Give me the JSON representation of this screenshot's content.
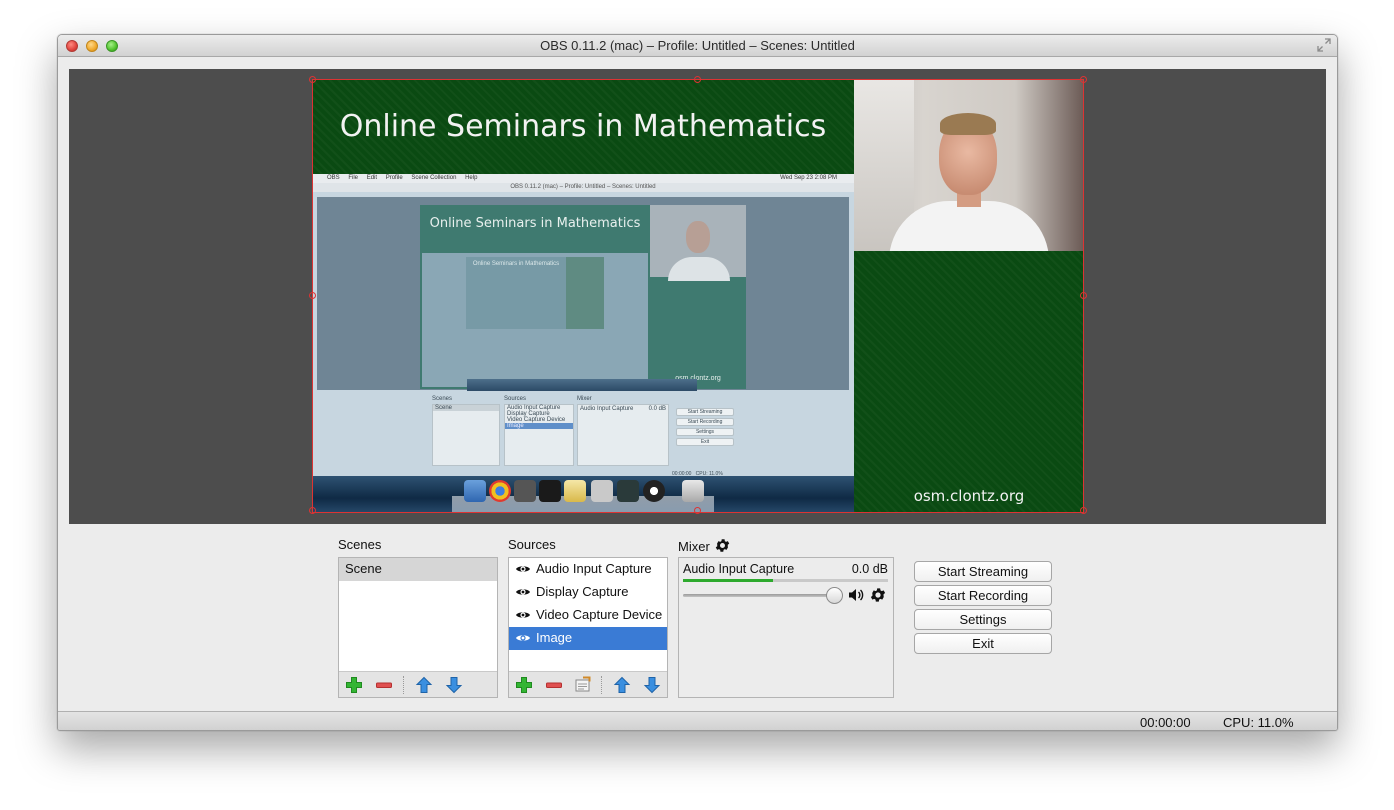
{
  "window": {
    "title": "OBS 0.11.2 (mac) – Profile: Untitled – Scenes: Untitled"
  },
  "preview": {
    "slide_title": "Online Seminars in Mathematics",
    "url_label": "osm.clontz.org",
    "nested": {
      "menubar": [
        "OBS",
        "File",
        "Edit",
        "Profile",
        "Scene Collection",
        "Help"
      ],
      "menubar_right": "Wed Sep 23  2:08 PM",
      "titlebar": "OBS 0.11.2 (mac) – Profile: Untitled – Scenes: Untitled",
      "slide_title": "Online Seminars in Mathematics",
      "inner_title": "Online Seminars in Mathematics",
      "url_label": "osm.clontz.org",
      "scenes_label": "Scenes",
      "scene_item": "Scene",
      "sources_label": "Sources",
      "sources": [
        "Audio Input Capture",
        "Display Capture",
        "Video Capture Device",
        "Image"
      ],
      "mixer_label": "Mixer",
      "mixer_item": "Audio Input Capture",
      "mixer_db": "0.0 dB",
      "buttons": [
        "Start Streaming",
        "Start Recording",
        "Settings",
        "Exit"
      ],
      "status_time": "00:00:00",
      "status_cpu": "CPU: 11.0%"
    }
  },
  "scenes": {
    "label": "Scenes",
    "items": [
      "Scene"
    ],
    "selected_index": 0
  },
  "sources": {
    "label": "Sources",
    "items": [
      "Audio Input Capture",
      "Display Capture",
      "Video Capture Device",
      "Image"
    ],
    "selected_index": 3
  },
  "mixer": {
    "label": "Mixer",
    "channel_name": "Audio Input Capture",
    "channel_db": "0.0 dB",
    "meter_level": 0.44,
    "volume_level": 1.0
  },
  "controls": {
    "start_streaming": "Start Streaming",
    "start_recording": "Start Recording",
    "settings": "Settings",
    "exit": "Exit"
  },
  "status": {
    "time": "00:00:00",
    "cpu": "CPU: 11.0%"
  },
  "icons": {
    "add": "plus-icon",
    "remove": "minus-icon",
    "properties": "properties-icon",
    "move_up": "arrow-up-icon",
    "move_down": "arrow-down-icon",
    "visibility": "eye-icon",
    "gear": "gear-icon",
    "speaker": "speaker-icon"
  },
  "colors": {
    "selection_blue": "#3a7bd5",
    "canvas_green": "#0b4a12",
    "selection_border_red": "#dd3333",
    "add_green": "#33b533",
    "remove_red": "#e05050",
    "arrow_blue": "#3a8fe0",
    "meter_green": "#2eaa2e"
  }
}
